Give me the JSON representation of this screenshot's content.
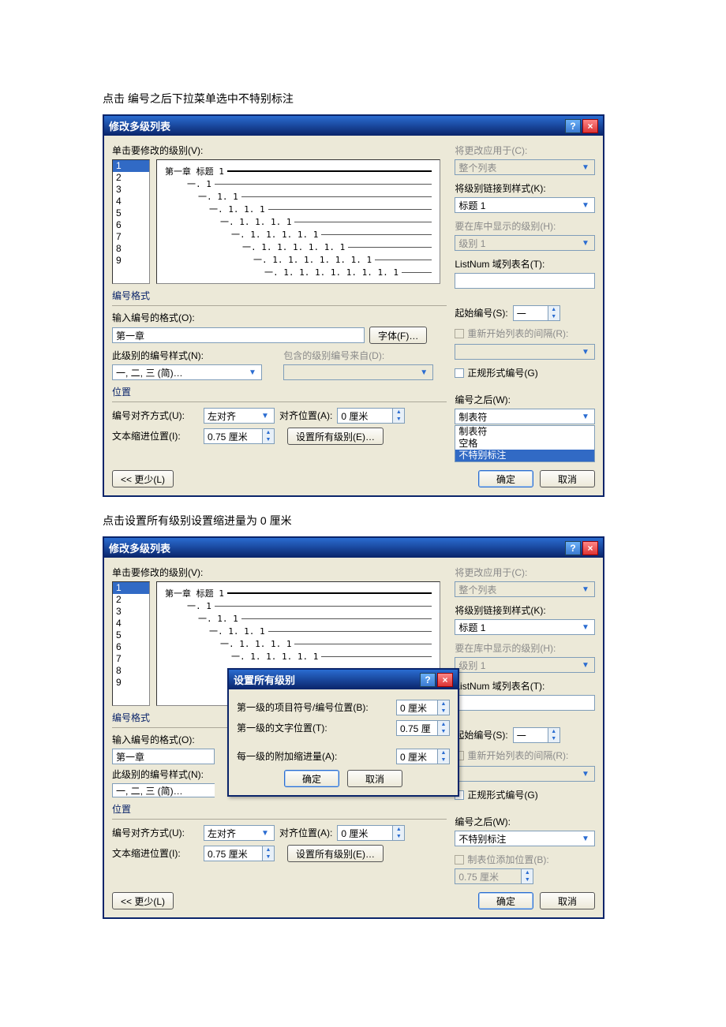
{
  "caption1": "点击  编号之后下拉菜单选中不特别标注",
  "caption2": "点击设置所有级别设置缩进量为 0 厘米",
  "dlg": {
    "title": "修改多级列表",
    "level_label": "单击要修改的级别(V):",
    "levels": [
      "1",
      "2",
      "3",
      "4",
      "5",
      "6",
      "7",
      "8",
      "9"
    ],
    "preview_heading": "第一章 标题 1",
    "preview_lines": [
      "一. 1",
      "一. 1. 1",
      "一. 1. 1. 1",
      "一. 1. 1. 1. 1",
      "一. 1. 1. 1. 1. 1",
      "一. 1. 1. 1. 1. 1. 1",
      "一. 1. 1. 1. 1. 1. 1. 1",
      "一. 1. 1. 1. 1. 1. 1. 1. 1"
    ],
    "sec_numfmt": "编号格式",
    "numfmt_label": "输入编号的格式(O):",
    "numfmt_value": "第一章",
    "font_btn": "字体(F)…",
    "style_label": "此级别的编号样式(N):",
    "style_value": "一, 二, 三 (简)…",
    "include_label": "包含的级别编号来自(D):",
    "sec_pos": "位置",
    "align_label": "编号对齐方式(U):",
    "align_value": "左对齐",
    "alignpos_label": "对齐位置(A):",
    "alignpos_value": "0 厘米",
    "indent_label": "文本缩进位置(I):",
    "indent_value": "0.75 厘米",
    "setall_btn": "设置所有级别(E)…",
    "less_btn": "<< 更少(L)",
    "ok_btn": "确定",
    "cancel_btn": "取消",
    "apply_label": "将更改应用于(C):",
    "apply_value": "整个列表",
    "link_label": "将级别链接到样式(K):",
    "link_value": "标题 1",
    "gallery_label": "要在库中显示的级别(H):",
    "gallery_value": "级别 1",
    "listnum_label": "ListNum 域列表名(T):",
    "start_label": "起始编号(S):",
    "start_value": "一",
    "restart_label": "重新开始列表的间隔(R):",
    "legal_label": "正规形式编号(G)",
    "after_label": "编号之后(W):",
    "after_value": "制表符",
    "after_opts": [
      "制表符",
      "空格",
      "不特别标注"
    ],
    "tabstop_label": "制表位添加位置(B):",
    "tabstop_value": "0.75 厘米"
  },
  "dlg2": {
    "after_value": "不特别标注"
  },
  "inner": {
    "title": "设置所有级别",
    "row1": "第一级的项目符号/编号位置(B):",
    "row1_v": "0 厘米",
    "row2": "第一级的文字位置(T):",
    "row2_v": "0.75 厘",
    "row3": "每一级的附加缩进量(A):",
    "row3_v": "0 厘米",
    "ok": "确定",
    "cancel": "取消"
  }
}
